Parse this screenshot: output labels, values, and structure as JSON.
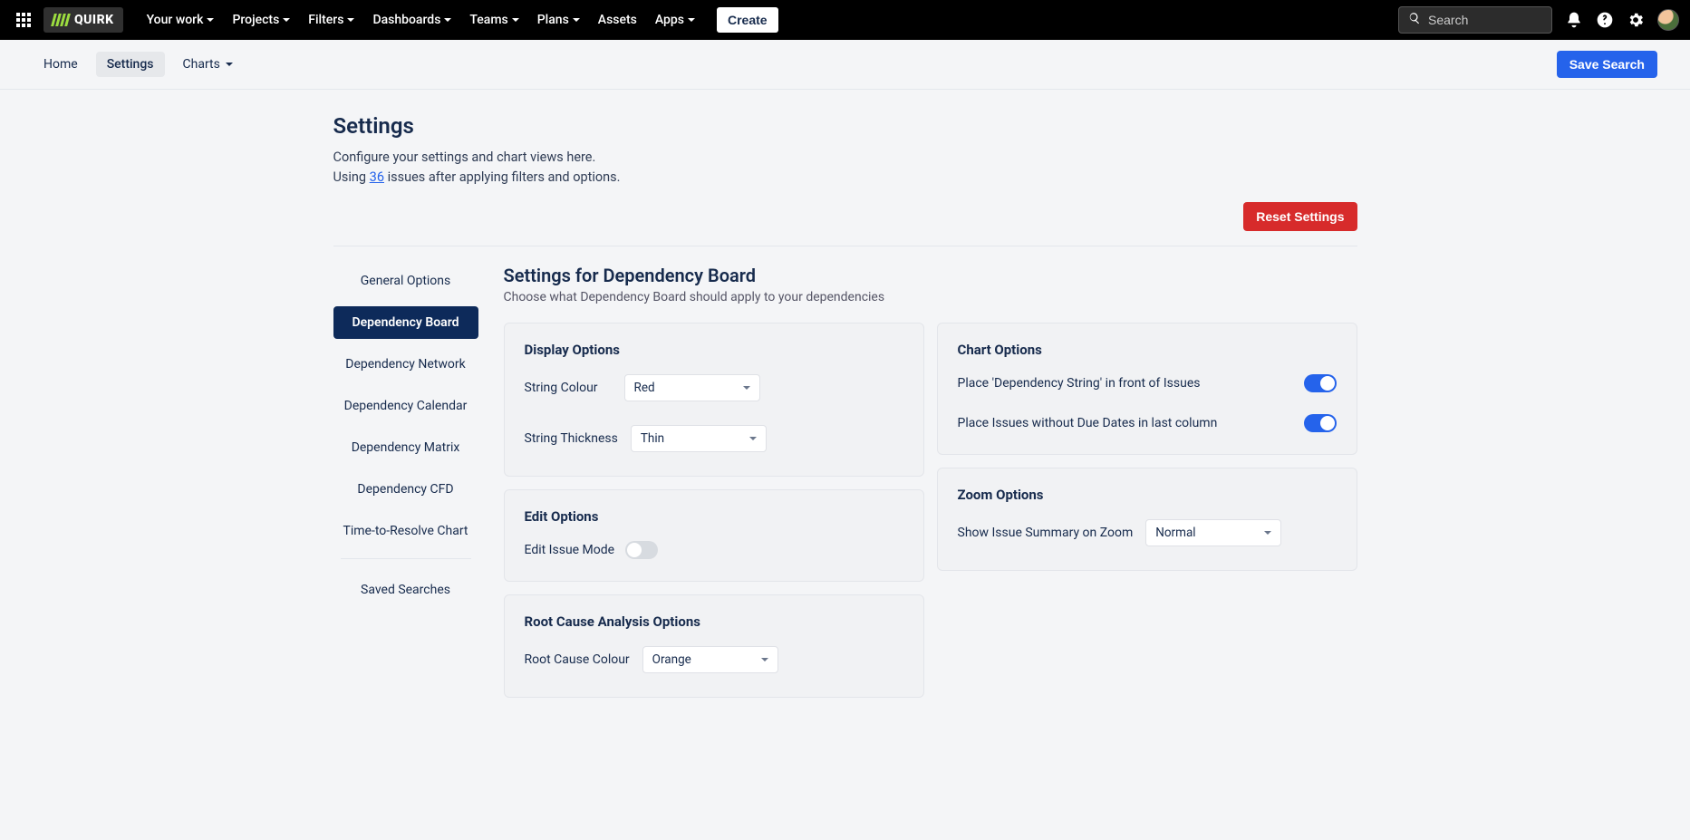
{
  "brand": {
    "name": "QUIRK"
  },
  "topnav": {
    "items": [
      {
        "label": "Your work",
        "dropdown": true
      },
      {
        "label": "Projects",
        "dropdown": true
      },
      {
        "label": "Filters",
        "dropdown": true
      },
      {
        "label": "Dashboards",
        "dropdown": true
      },
      {
        "label": "Teams",
        "dropdown": true
      },
      {
        "label": "Plans",
        "dropdown": true
      },
      {
        "label": "Assets",
        "dropdown": false
      },
      {
        "label": "Apps",
        "dropdown": true
      }
    ],
    "create": "Create",
    "search_placeholder": "Search"
  },
  "subnav": {
    "tabs": [
      {
        "label": "Home",
        "active": false,
        "dropdown": false
      },
      {
        "label": "Settings",
        "active": true,
        "dropdown": false
      },
      {
        "label": "Charts",
        "active": false,
        "dropdown": true
      }
    ],
    "save_search": "Save Search"
  },
  "header": {
    "title": "Settings",
    "line1": "Configure your settings and chart views here.",
    "line2_before": "Using ",
    "line2_link": "36",
    "line2_after": " issues after applying filters and options.",
    "reset": "Reset Settings"
  },
  "sidenav": {
    "items": [
      {
        "label": "General Options",
        "active": false
      },
      {
        "label": "Dependency Board",
        "active": true
      },
      {
        "label": "Dependency Network",
        "active": false
      },
      {
        "label": "Dependency Calendar",
        "active": false
      },
      {
        "label": "Dependency Matrix",
        "active": false
      },
      {
        "label": "Dependency CFD",
        "active": false
      },
      {
        "label": "Time-to-Resolve Chart",
        "active": false
      }
    ],
    "saved": "Saved Searches"
  },
  "panel": {
    "title": "Settings for Dependency Board",
    "subtitle": "Choose what Dependency Board should apply to your dependencies",
    "cards": {
      "display": {
        "title": "Display Options",
        "string_colour_label": "String Colour",
        "string_colour_value": "Red",
        "string_thickness_label": "String Thickness",
        "string_thickness_value": "Thin"
      },
      "chart": {
        "title": "Chart Options",
        "opt1": "Place 'Dependency String' in front of Issues",
        "opt1_on": true,
        "opt2": "Place Issues without Due Dates in last column",
        "opt2_on": true
      },
      "edit": {
        "title": "Edit Options",
        "mode_label": "Edit Issue Mode",
        "mode_on": false
      },
      "zoom": {
        "title": "Zoom Options",
        "summary_label": "Show Issue Summary on Zoom",
        "summary_value": "Normal"
      },
      "root": {
        "title": "Root Cause Analysis Options",
        "colour_label": "Root Cause Colour",
        "colour_value": "Orange"
      }
    }
  }
}
